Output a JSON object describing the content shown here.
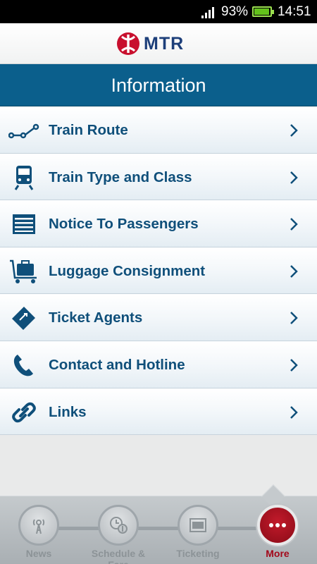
{
  "status_bar": {
    "battery_percent": "93%",
    "time": "14:51",
    "icons": [
      "signal-icon",
      "battery-icon"
    ]
  },
  "header": {
    "logo_text": "MTR",
    "title": "Information"
  },
  "menu": {
    "items": [
      {
        "label": "Train Route",
        "icon": "route-icon"
      },
      {
        "label": "Train Type and Class",
        "icon": "train-icon"
      },
      {
        "label": "Notice To Passengers",
        "icon": "notice-board-icon"
      },
      {
        "label": "Luggage Consignment",
        "icon": "luggage-cart-icon"
      },
      {
        "label": "Ticket Agents",
        "icon": "ticket-icon"
      },
      {
        "label": "Contact and Hotline",
        "icon": "phone-icon"
      },
      {
        "label": "Links",
        "icon": "link-icon"
      }
    ]
  },
  "tabbar": {
    "tabs": [
      {
        "label": "News",
        "icon": "news-icon",
        "active": false
      },
      {
        "label": "Schedule & Fare",
        "icon": "schedule-fare-icon",
        "active": false
      },
      {
        "label": "Ticketing",
        "icon": "ticketing-icon",
        "active": false
      },
      {
        "label": "More",
        "icon": "more-icon",
        "active": true
      }
    ]
  },
  "colors": {
    "title_bar": "#0b5f8c",
    "menu_text": "#0f4f7a",
    "active_tab": "#a3081a",
    "brand_red": "#c8102e",
    "brand_blue": "#1d3f7a"
  }
}
